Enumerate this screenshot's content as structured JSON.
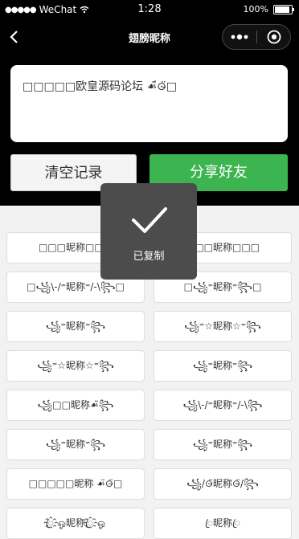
{
  "status_bar": {
    "carrier": "WeChat",
    "time": "1:28",
    "battery_percent": "100%"
  },
  "nav": {
    "title": "翅膀昵称"
  },
  "header": {
    "text_card": "□□□□□欧皇源码论坛 ☙̈́⊙̵̈□",
    "clear_label": "清空记录",
    "share_label": "分享好友"
  },
  "toast": {
    "text": "已复制"
  },
  "nicknames": [
    "□□□昵称□□□",
    "□□□昵称□□□",
    "□꧁\\-/⁼昵称⁼/-\\꧂□",
    "□꧁⁼昵称⁼꧂□",
    "꧁⁼昵称⁼꧂",
    "꧁⁼☆昵称☆⁼꧂",
    "꧁⁼☆昵称☆⁼꧂",
    "꧁⁼昵称⁼꧂",
    "꧁□□昵称☙̈̈꧂",
    "꧁\\-/⁼昵称⁼/-\\꧂",
    "꧁⁼昵称⁼꧂",
    "꧁⁼昵称⁼꧂",
    "□□□□□昵称 ☙̈⊙̵̈□",
    "꧁/⊙̵̈昵称⊙̵̈/꧂",
    "ꦿ҈ஓ昵称ꦿ҈ஓ",
    "ꦿ昵称ꦿ"
  ]
}
